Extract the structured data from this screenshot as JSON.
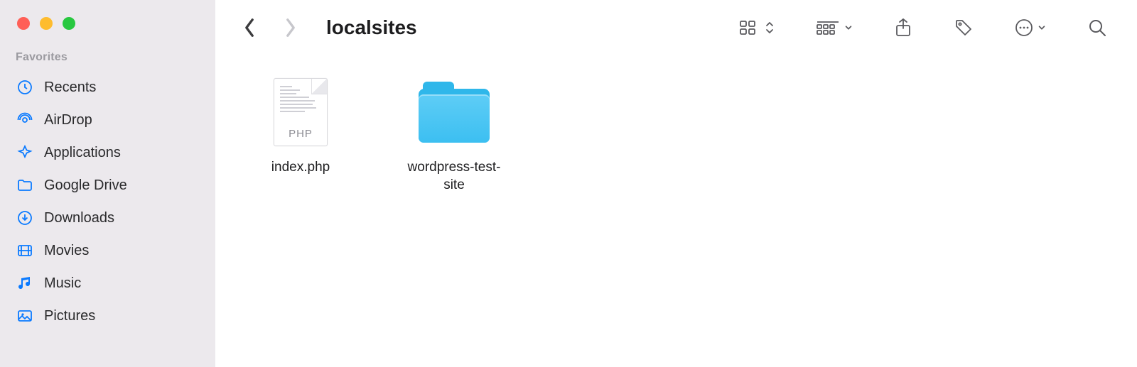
{
  "window": {
    "title": "localsites"
  },
  "sidebar": {
    "section_label": "Favorites",
    "items": [
      {
        "icon": "clock-icon",
        "label": "Recents"
      },
      {
        "icon": "airdrop-icon",
        "label": "AirDrop"
      },
      {
        "icon": "applications-icon",
        "label": "Applications"
      },
      {
        "icon": "folder-icon",
        "label": "Google Drive"
      },
      {
        "icon": "downloads-icon",
        "label": "Downloads"
      },
      {
        "icon": "movies-icon",
        "label": "Movies"
      },
      {
        "icon": "music-icon",
        "label": "Music"
      },
      {
        "icon": "pictures-icon",
        "label": "Pictures"
      }
    ]
  },
  "items": [
    {
      "type": "file",
      "kind": "php",
      "badge": "PHP",
      "label": "index.php"
    },
    {
      "type": "folder",
      "label": "wordpress-test-site"
    }
  ]
}
